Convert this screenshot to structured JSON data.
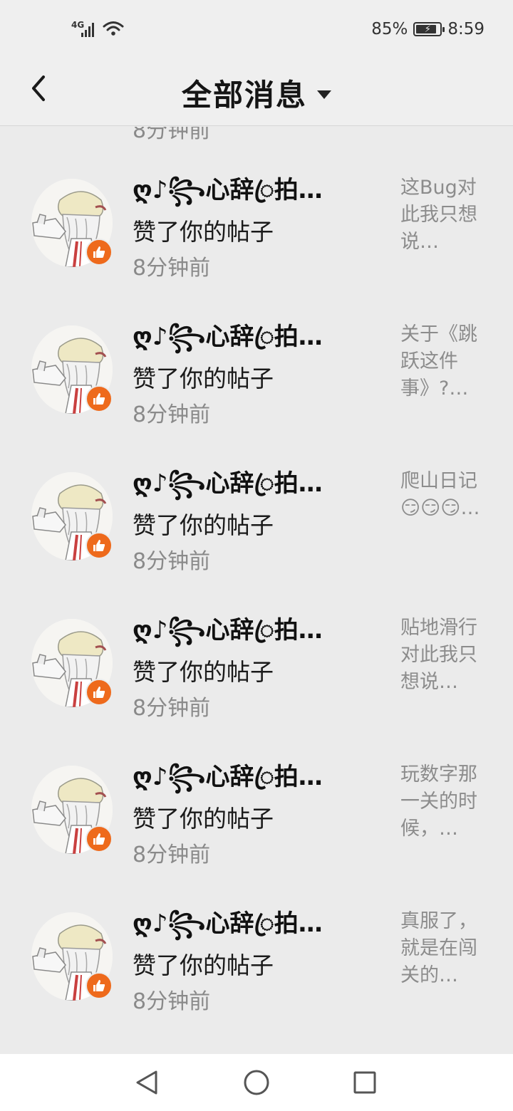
{
  "status_bar": {
    "network": "4G",
    "battery": "85%",
    "battery_fraction": 0.85,
    "time": "8:59"
  },
  "header": {
    "title": "全部消息"
  },
  "partial_item": {
    "time": "8分钟前"
  },
  "messages": [
    {
      "username": "ღ♪꧂心辞ꦿ拍…",
      "action": "赞了你的帖子",
      "time": "8分钟前",
      "preview": "这Bug对此我只想说…"
    },
    {
      "username": "ღ♪꧂心辞ꦿ拍…",
      "action": "赞了你的帖子",
      "time": "8分钟前",
      "preview": "关于《跳跃这件事》?…"
    },
    {
      "username": "ღ♪꧂心辞ꦿ拍…",
      "action": "赞了你的帖子",
      "time": "8分钟前",
      "preview": "爬山日记😏😏😏…"
    },
    {
      "username": "ღ♪꧂心辞ꦿ拍…",
      "action": "赞了你的帖子",
      "time": "8分钟前",
      "preview": "贴地滑行对此我只想说…"
    },
    {
      "username": "ღ♪꧂心辞ꦿ拍…",
      "action": "赞了你的帖子",
      "time": "8分钟前",
      "preview": "玩数字那一关的时候，…"
    },
    {
      "username": "ღ♪꧂心辞ꦿ拍…",
      "action": "赞了你的帖子",
      "time": "8分钟前",
      "preview": "真服了，就是在闯关的…"
    }
  ],
  "colors": {
    "accent": "#ee6a1c",
    "background": "#ebebeb"
  }
}
